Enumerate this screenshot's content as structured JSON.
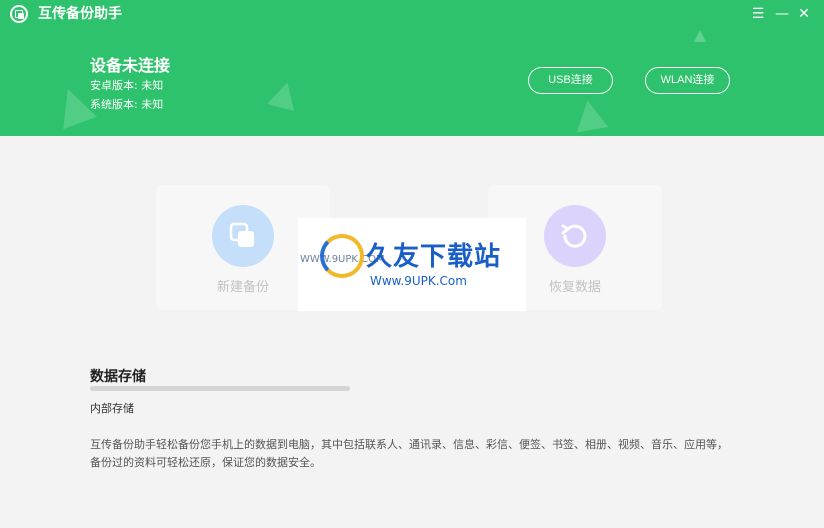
{
  "app": {
    "title": "互传备份助手",
    "window_controls": {
      "menu": "☰",
      "minimize": "—",
      "close": "✕"
    }
  },
  "device": {
    "status": "设备未连接",
    "android_version": "安卓版本: 未知",
    "system_version": "系统版本: 未知"
  },
  "connect": {
    "usb_label": "USB连接",
    "wlan_label": "WLAN连接"
  },
  "actions": {
    "new_backup_label": "新建备份",
    "restore_label": "恢复数据"
  },
  "watermark": {
    "text": "久友下载站",
    "url": "Www.9UPK.Com",
    "side_url": "WWW.9UPK.COM"
  },
  "storage": {
    "title": "数据存储",
    "location": "内部存储",
    "used_fraction": 0.0,
    "description": "互传备份助手轻松备份您手机上的数据到电脑，其中包括联系人、通讯录、信息、彩信、便签、书签、相册、视频、音乐、应用等，备份过的资料可轻松还原，保证您的数据安全。"
  },
  "colors": {
    "brand": "#2dc26b",
    "new_backup_icon": "#c5dffb",
    "restore_icon": "#dbd3fb"
  }
}
